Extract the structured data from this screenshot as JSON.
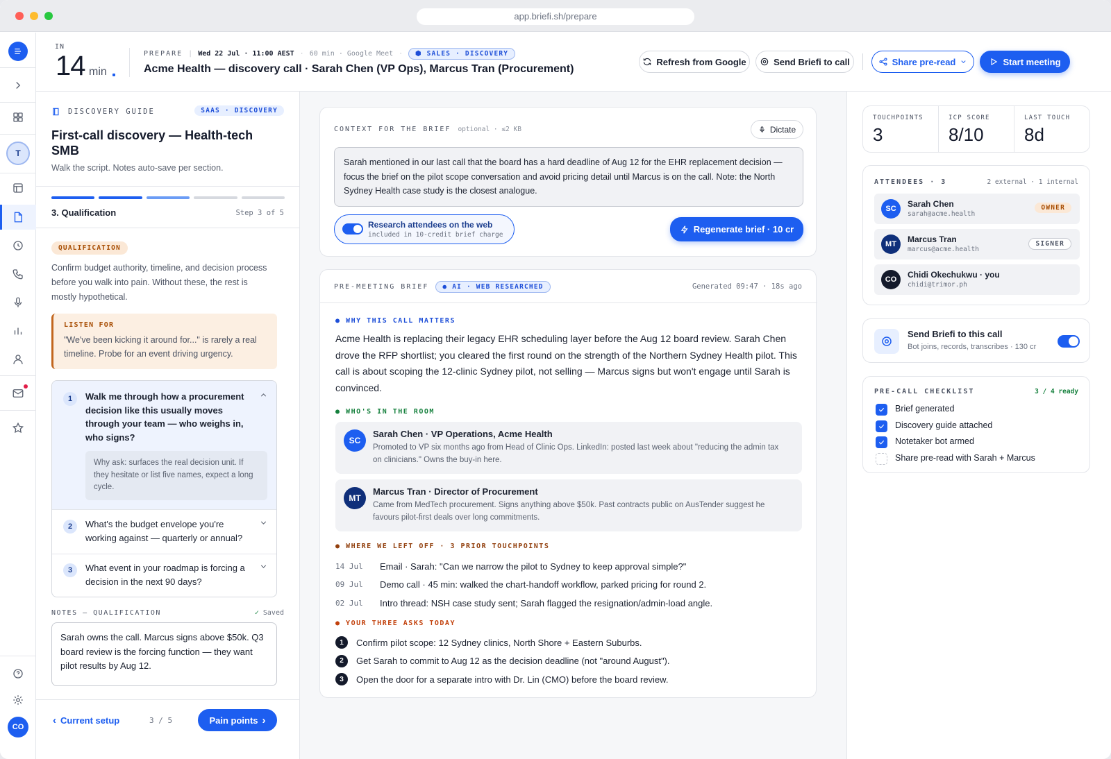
{
  "browser": {
    "url": "app.briefi.sh/prepare"
  },
  "rail": {
    "avatar": "T",
    "user_avatar": "CO"
  },
  "header": {
    "countdown_prefix": "IN",
    "countdown_value": "14",
    "countdown_unit": "min",
    "stage": "PREPARE",
    "datetime": "Wed 22 Jul · 11:00 AEST",
    "duration": "60 min · Google Meet",
    "tag": "SALES · DISCOVERY",
    "title": "Acme Health — discovery call · Sarah Chen (VP Ops), Marcus Tran (Procurement)",
    "refresh_label": "Refresh from Google",
    "send_label": "Send Briefi to call",
    "share_label": "Share pre-read",
    "start_label": "Start meeting"
  },
  "guide": {
    "label": "DISCOVERY GUIDE",
    "tag": "SAAS · DISCOVERY",
    "title": "First-call discovery — Health-tech SMB",
    "subtitle": "Walk the script. Notes auto-save per section.",
    "progress": {
      "step": 3,
      "total": 5
    },
    "step_title": "3. Qualification",
    "step_count": "Step 3 of 5",
    "section_tag": "QUALIFICATION",
    "section_desc": "Confirm budget authority, timeline, and decision process before you walk into pain. Without these, the rest is mostly hypothetical.",
    "listen_label": "LISTEN FOR",
    "listen_text": "\"We've been kicking it around for...\" is rarely a real timeline. Probe for an event driving urgency.",
    "questions": [
      {
        "num": "1",
        "text": "Walk me through how a procurement decision like this usually moves through your team — who weighs in, who signs?",
        "why": "Why ask: surfaces the real decision unit. If they hesitate or list five names, expect a long cycle."
      },
      {
        "num": "2",
        "text": "What's the budget envelope you're working against — quarterly or annual?"
      },
      {
        "num": "3",
        "text": "What event in your roadmap is forcing a decision in the next 90 days?"
      }
    ],
    "notes_label": "NOTES — QUALIFICATION",
    "notes_saved": "Saved",
    "notes_text": "Sarah owns the call. Marcus signs above $50k. Q3 board review is the forcing function — they want pilot results by Aug 12.",
    "back_label": "Current setup",
    "page": "3 / 5",
    "next_label": "Pain points"
  },
  "context": {
    "label": "CONTEXT FOR THE BRIEF",
    "hint": "optional · ≤2 KB",
    "dictate": "Dictate",
    "text": "Sarah mentioned in our last call that the board has a hard deadline of Aug 12 for the EHR replacement decision — focus the brief on the pilot scope conversation and avoid pricing detail until Marcus is on the call. Note: the North Sydney Health case study is the closest analogue.",
    "research_title": "Research attendees on the web",
    "research_sub": "included in 10-credit brief charge",
    "regen_label": "Regenerate brief · 10 cr"
  },
  "brief": {
    "label": "PRE-MEETING BRIEF",
    "tag": "AI · WEB RESEARCHED",
    "generated": "Generated 09:47 · 18s ago",
    "why_h": "WHY THIS CALL MATTERS",
    "why_text": "Acme Health is replacing their legacy EHR scheduling layer before the Aug 12 board review. Sarah Chen drove the RFP shortlist; you cleared the first round on the strength of the Northern Sydney Health pilot. This call is about scoping the 12-clinic Sydney pilot, not selling — Marcus signs but won't engage until Sarah is convinced.",
    "room_h": "WHO'S IN THE ROOM",
    "people": [
      {
        "init": "SC",
        "name": "Sarah Chen · VP Operations, Acme Health",
        "desc": "Promoted to VP six months ago from Head of Clinic Ops. LinkedIn: posted last week about \"reducing the admin tax on clinicians.\" Owns the buy-in here."
      },
      {
        "init": "MT",
        "name": "Marcus Tran · Director of Procurement",
        "desc": "Came from MedTech procurement. Signs anything above $50k. Past contracts public on AusTender suggest he favours pilot-first deals over long commitments."
      }
    ],
    "left_h": "WHERE WE LEFT OFF · 3 PRIOR TOUCHPOINTS",
    "touchpoints": [
      {
        "date": "14 Jul",
        "text": "Email · Sarah: \"Can we narrow the pilot to Sydney to keep approval simple?\""
      },
      {
        "date": "09 Jul",
        "text": "Demo call · 45 min: walked the chart-handoff workflow, parked pricing for round 2."
      },
      {
        "date": "02 Jul",
        "text": "Intro thread: NSH case study sent; Sarah flagged the resignation/admin-load angle."
      }
    ],
    "asks_h": "YOUR THREE ASKS TODAY",
    "asks": [
      {
        "num": "1",
        "text": "Confirm pilot scope: 12 Sydney clinics, North Shore + Eastern Suburbs."
      },
      {
        "num": "2",
        "text": "Get Sarah to commit to Aug 12 as the decision deadline (not \"around August\")."
      },
      {
        "num": "3",
        "text": "Open the door for a separate intro with Dr. Lin (CMO) before the board review."
      }
    ]
  },
  "stats": [
    {
      "label": "TOUCHPOINTS",
      "value": "3"
    },
    {
      "label": "ICP SCORE",
      "value": "8/10"
    },
    {
      "label": "LAST TOUCH",
      "value": "8d"
    }
  ],
  "attendees": {
    "label": "ATTENDEES · 3",
    "summary": "2 external · 1 internal",
    "list": [
      {
        "init": "SC",
        "name": "Sarah Chen",
        "email": "sarah@acme.health",
        "badge": "OWNER"
      },
      {
        "init": "MT",
        "name": "Marcus Tran",
        "email": "marcus@acme.health",
        "badge": "SIGNER"
      },
      {
        "init": "CO",
        "name": "Chidi Okechukwu · you",
        "email": "chidi@trimor.ph",
        "badge": ""
      }
    ]
  },
  "bot": {
    "title": "Send Briefi to this call",
    "sub": "Bot joins, records, transcribes · 130 cr",
    "enabled": true
  },
  "checklist": {
    "label": "PRE-CALL CHECKLIST",
    "status": "3 / 4 ready",
    "items": [
      {
        "text": "Brief generated",
        "checked": true
      },
      {
        "text": "Discovery guide attached",
        "checked": true
      },
      {
        "text": "Notetaker bot armed",
        "checked": true
      },
      {
        "text": "Share pre-read with Sarah + Marcus",
        "checked": false
      }
    ]
  },
  "colors": {
    "accent": "#1d5ef0",
    "navy": "#0f2f7a",
    "amber": "#b45309",
    "green": "#15803d",
    "red": "#c2410c"
  }
}
